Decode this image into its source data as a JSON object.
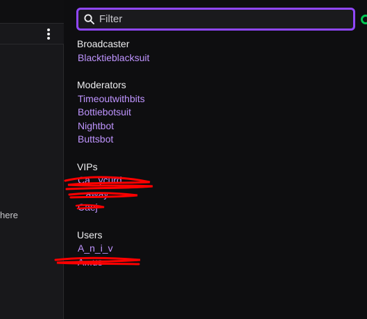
{
  "left": {
    "partial_text": "here",
    "menu_icon": "kebab-vertical-icon"
  },
  "filter": {
    "placeholder": "Filter",
    "value": "",
    "icon": "search-icon",
    "focus_color": "#9147ff"
  },
  "colors": {
    "background": "#0e0e10",
    "username": "#bf94ff",
    "section_heading": "#efeff1",
    "redaction": "#ff0000",
    "status_indicator": "#00c853"
  },
  "sections": {
    "broadcaster": {
      "title": "Broadcaster",
      "users": [
        "Blacktieblacksuit"
      ]
    },
    "moderators": {
      "title": "Moderators",
      "users": [
        "Timeoutwithbits",
        "Bottiebotsuit",
        "Nightbot",
        "Buttsbot"
      ]
    },
    "vips": {
      "title": "VIPs",
      "users": [
        "Ca...ycurd",
        "...away",
        "Caej"
      ],
      "redacted": true
    },
    "users": {
      "title": "Users",
      "users": [
        "A_n_i_v",
        "A...us"
      ],
      "redacted_indices": [
        1
      ]
    }
  }
}
